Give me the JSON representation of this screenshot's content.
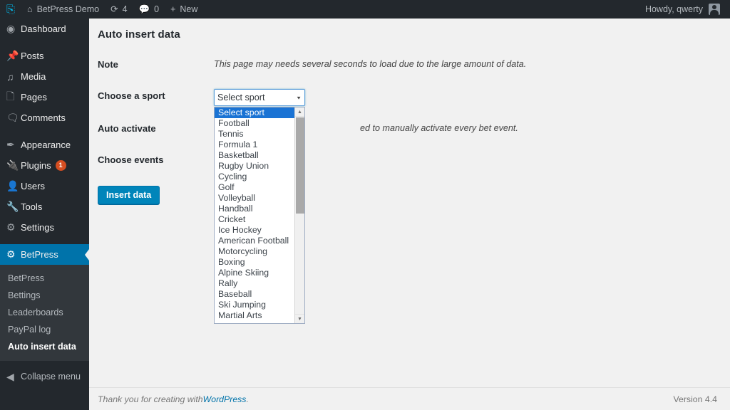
{
  "adminbar": {
    "logo_icon": "wordpress-logo-icon",
    "site_name": "BetPress Demo",
    "site_icon": "home-icon",
    "updates_icon": "updates-icon",
    "updates_count": "4",
    "comments_icon": "comment-bubble-icon",
    "comments_count": "0",
    "new_icon": "plus-icon",
    "new_label": "New",
    "howdy": "Howdy, qwerty",
    "avatar_icon": "user-avatar-icon"
  },
  "sidebar": {
    "items": [
      {
        "label": "Dashboard",
        "icon": "dashboard-icon"
      },
      {
        "label": "Posts",
        "icon": "pin-icon"
      },
      {
        "label": "Media",
        "icon": "media-icon"
      },
      {
        "label": "Pages",
        "icon": "page-icon"
      },
      {
        "label": "Comments",
        "icon": "comment-icon"
      },
      {
        "label": "Appearance",
        "icon": "paintbrush-icon"
      },
      {
        "label": "Plugins",
        "icon": "plug-icon",
        "badge": "1"
      },
      {
        "label": "Users",
        "icon": "user-icon"
      },
      {
        "label": "Tools",
        "icon": "wrench-icon"
      },
      {
        "label": "Settings",
        "icon": "settings-sliders-icon"
      },
      {
        "label": "BetPress",
        "icon": "gear-icon",
        "current": true
      }
    ],
    "submenu": [
      {
        "label": "BetPress"
      },
      {
        "label": "Bettings"
      },
      {
        "label": "Leaderboards"
      },
      {
        "label": "PayPal log"
      },
      {
        "label": "Auto insert data",
        "current": true
      }
    ],
    "collapse": {
      "label": "Collapse menu",
      "icon": "collapse-arrow-icon"
    }
  },
  "page": {
    "title": "Auto insert data",
    "rows": {
      "note": {
        "label": "Note",
        "text": "This page may needs several seconds to load due to the large amount of data."
      },
      "sport": {
        "label": "Choose a sport",
        "selected": "Select sport",
        "caret_icon": "chevron-down-icon"
      },
      "auto_activate": {
        "label": "Auto activate",
        "text": "ed to manually activate every bet event."
      },
      "events": {
        "label": "Choose events"
      }
    },
    "submit_label": "Insert data"
  },
  "dropdown": {
    "scroll_up_icon": "scroll-up-arrow-icon",
    "scroll_down_icon": "scroll-down-arrow-icon",
    "options": [
      "Select sport",
      "Football",
      "Tennis",
      "Formula 1",
      "Basketball",
      "Rugby Union",
      "Cycling",
      "Golf",
      "Volleyball",
      "Handball",
      "Cricket",
      "Ice Hockey",
      "American Football",
      "Motorcycling",
      "Boxing",
      "Alpine Skiing",
      "Rally",
      "Baseball",
      "Ski Jumping",
      "Martial Arts"
    ],
    "selected_index": 0
  },
  "footer": {
    "thanks_prefix": "Thank you for creating with ",
    "wordpress_link": "WordPress",
    "thanks_suffix": ".",
    "version": "Version 4.4"
  },
  "colors": {
    "admin_bar": "#23282d",
    "sidebar": "#23282d",
    "submenu": "#32373c",
    "accent": "#0073aa",
    "button": "#0085ba",
    "badge": "#d54e21",
    "dropdown_highlight": "#1a73d4"
  }
}
